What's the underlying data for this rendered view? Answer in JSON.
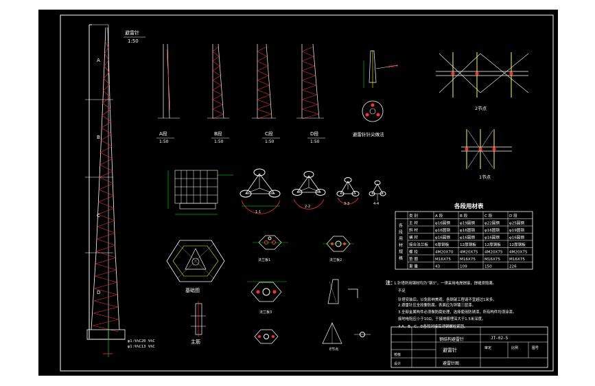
{
  "colors": {
    "paper": "#ffffff",
    "background": "#000000",
    "frame": "#ffffff",
    "tower": "#ffffff",
    "member": "#ff3030",
    "dimension": "#00ff00",
    "text": "#ffffff",
    "label": "#ffff00",
    "detail": "#ffff40"
  },
  "icons": [
    "tower-elevation",
    "tower-segment",
    "cross-section",
    "joint-detail",
    "base-plan",
    "anchor-bolt"
  ],
  "main_view": {
    "title": "避雷针",
    "scale": "1:50",
    "sections": [
      "A",
      "B",
      "C",
      "D"
    ],
    "footnote_1": "φ1:%%C20 %%C",
    "footnote_2": "φ1:%%C13 %%C"
  },
  "segments": [
    {
      "label": "A段",
      "scale": "1:50"
    },
    {
      "label": "B段",
      "scale": "1:50"
    },
    {
      "label": "C段",
      "scale": "1:50"
    },
    {
      "label": "D段",
      "scale": "1:50"
    }
  ],
  "top_detail": {
    "title": "避雷针针尖做法"
  },
  "nodes": {
    "node2": "2节点",
    "node1": "1节点"
  },
  "table": {
    "title": "各段用材表",
    "headers": [
      "",
      "类 别",
      "A 段",
      "B 段",
      "C 段",
      "D 段"
    ],
    "side_label": "各段用材规格",
    "rows": [
      [
        "主 材",
        "φ16圆钢",
        "φ19圆钢",
        "φ22圆钢",
        "φ25圆钢"
      ],
      [
        "斜 材",
        "φ16圆钢",
        "φ16圆钢",
        "φ16圆钢",
        "φ19圆钢"
      ],
      [
        "横 材",
        "φ16圆钢",
        "φ16圆钢",
        "φ16圆钢",
        "φ16圆钢"
      ],
      [
        "接合法兰板",
        "6厚钢板",
        "12厚钢板",
        "12厚钢板",
        "12厚钢板"
      ],
      [
        "螺 栓",
        "4M20X70",
        "4M20X75",
        "4M20X75",
        "4M20X75"
      ],
      [
        "垫 圈",
        "M16X75",
        "M16X75",
        "M16X75",
        "M16X75"
      ],
      [
        "重 量",
        "43",
        "109",
        "150",
        "226"
      ]
    ]
  },
  "notes": {
    "heading": "注：",
    "lines": [
      "1.针塔所用钢材均为“钢3”，一律采用电焊焊接，焊缝须饱满。",
      "不足",
      "针塔安装后，以免影响美观，各钢架工程请不宜超过1米多。",
      "2.避雷针应全段要防腐。表面应为锌镀三层漆。",
      "3.全部金属构件必须做防腐处理，选择使用防锈漆，所有构件均须涂漆。",
      "接地电阻应小于10Ω，于接地极埋深大于1.5米深度。",
      "4.A、B、C、D各段对接后请钢螺栓紧固。"
    ]
  },
  "title_block": {
    "project": "钢结构避雷针",
    "drawing_no": "JT-02-5",
    "drawing_name": "避雷针",
    "sheet": "避雷针图",
    "labels": [
      "设计",
      "校核",
      "审定",
      "比例",
      "图号"
    ]
  },
  "labels": {
    "foundation_plan": "基础图",
    "main_bar": "主筋",
    "section_1": "1-1",
    "section_2": "2-2",
    "section_3": "3-3",
    "section_4": "4-4",
    "plate_a": "法兰板1",
    "plate_b": "法兰板2",
    "plate_c": "法兰板3",
    "detail_e": "E节点"
  }
}
